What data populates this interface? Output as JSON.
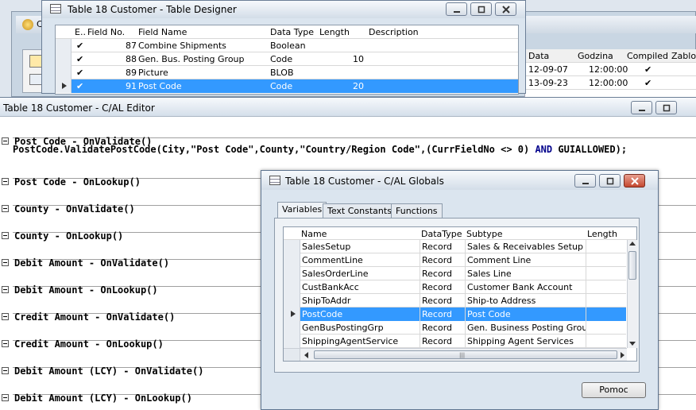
{
  "background_window": {
    "title_fragment": "C",
    "columns": [
      "Data",
      "Godzina",
      "Compiled",
      "Zabloko"
    ],
    "rows": [
      {
        "date": "12-09-07",
        "time": "12:00:00",
        "compiled": true
      },
      {
        "date": "13-09-23",
        "time": "12:00:00",
        "compiled": true
      }
    ]
  },
  "designer": {
    "title": "Table 18 Customer - Table Designer",
    "columns": [
      "E..",
      "Field No.",
      "Field Name",
      "Data Type",
      "Length",
      "Description"
    ],
    "rows": [
      {
        "enabled": true,
        "no": "87",
        "name": "Combine Shipments",
        "type": "Boolean",
        "length": ""
      },
      {
        "enabled": true,
        "no": "88",
        "name": "Gen. Bus. Posting Group",
        "type": "Code",
        "length": "10"
      },
      {
        "enabled": true,
        "no": "89",
        "name": "Picture",
        "type": "BLOB",
        "length": ""
      },
      {
        "enabled": true,
        "no": "91",
        "name": "Post Code",
        "type": "Code",
        "length": "20",
        "selected": true
      }
    ]
  },
  "editor": {
    "title": "Table 18 Customer - C/AL Editor",
    "code_line": {
      "prefix": "PostCode.ValidatePostCode(City,\"Post Code\",County,\"Country/Region Code\",(CurrFieldNo <> 0) ",
      "keyword": "AND",
      "suffix": " GUIALLOWED);"
    },
    "triggers": [
      "Post Code - OnValidate()",
      "Post Code - OnLookup()",
      "County - OnValidate()",
      "County - OnLookup()",
      "Debit Amount - OnValidate()",
      "Debit Amount - OnLookup()",
      "Credit Amount - OnValidate()",
      "Credit Amount - OnLookup()",
      "Debit Amount (LCY) - OnValidate()",
      "Debit Amount (LCY) - OnLookup()"
    ],
    "keyword_color": "#00008b"
  },
  "globals": {
    "title": "Table 18 Customer - C/AL Globals",
    "tabs": [
      "Variables",
      "Text Constants",
      "Functions"
    ],
    "active_tab": "Variables",
    "columns": [
      "Name",
      "DataType",
      "Subtype",
      "Length"
    ],
    "rows": [
      {
        "name": "SalesSetup",
        "type": "Record",
        "subtype": "Sales & Receivables Setup"
      },
      {
        "name": "CommentLine",
        "type": "Record",
        "subtype": "Comment Line"
      },
      {
        "name": "SalesOrderLine",
        "type": "Record",
        "subtype": "Sales Line"
      },
      {
        "name": "CustBankAcc",
        "type": "Record",
        "subtype": "Customer Bank Account"
      },
      {
        "name": "ShipToAddr",
        "type": "Record",
        "subtype": "Ship-to Address"
      },
      {
        "name": "PostCode",
        "type": "Record",
        "subtype": "Post Code",
        "selected": true
      },
      {
        "name": "GenBusPostingGrp",
        "type": "Record",
        "subtype": "Gen. Business Posting Group"
      },
      {
        "name": "ShippingAgentService",
        "type": "Record",
        "subtype": "Shipping Agent Services"
      }
    ],
    "help_button": "Pomoc",
    "selection_color": "#3399ff"
  }
}
